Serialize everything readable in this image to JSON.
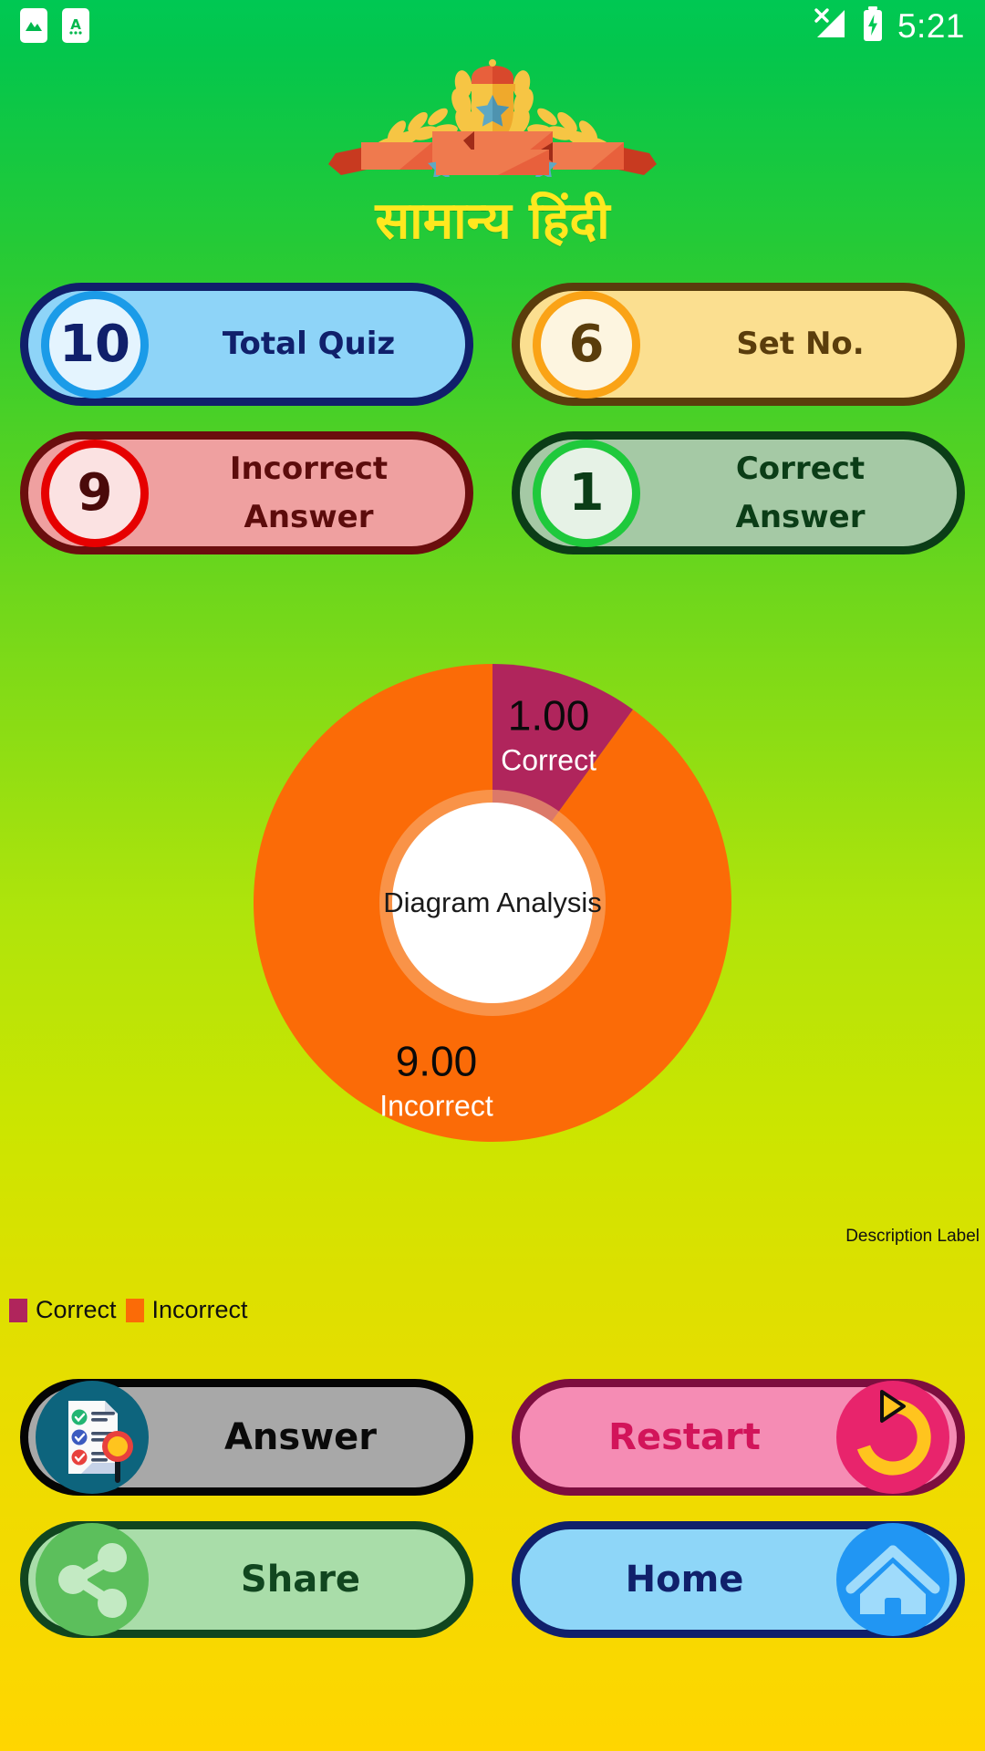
{
  "status_bar": {
    "time": "5:21",
    "icons": [
      "image-notification-icon",
      "app-notification-icon",
      "signal-no-service-icon",
      "battery-charging-icon"
    ]
  },
  "header": {
    "title": "सामान्य हिंदी",
    "trophy_icon": "trophy-banner-icon"
  },
  "stats": [
    {
      "value": "10",
      "label": "Total Quiz",
      "name": "total-quiz"
    },
    {
      "value": "6",
      "label": "Set No.",
      "name": "set-no"
    },
    {
      "value": "9",
      "label": "Incorrect\nAnswer",
      "line1": "Incorrect",
      "line2": "Answer",
      "name": "incorrect-answer"
    },
    {
      "value": "1",
      "label": "Correct\nAnswer",
      "line1": "Correct",
      "line2": "Answer",
      "name": "correct-answer"
    }
  ],
  "chart_data": {
    "type": "pie",
    "variant": "donut",
    "title": "Diagram Analysis",
    "center_label": "Diagram Analysis",
    "description_label": "Description Label",
    "categories": [
      "Correct",
      "Incorrect"
    ],
    "values": [
      1.0,
      9.0
    ],
    "value_labels": [
      "1.00",
      "9.00"
    ],
    "colors": [
      "#B0255C",
      "#FB6B07"
    ],
    "total": 10,
    "start_angle_deg": 0,
    "direction": "clockwise",
    "inner_radius_ratio": 0.42,
    "inner_ring_color": "#F7AC71",
    "center_fill": "#FFFFFF",
    "legend": {
      "position": "bottom-left",
      "entries": [
        {
          "label": "Correct",
          "color": "#B0255C"
        },
        {
          "label": "Incorrect",
          "color": "#FB6B07"
        }
      ]
    },
    "grid": false,
    "xlabel": "",
    "ylabel": ""
  },
  "actions": [
    {
      "label": "Answer",
      "name": "answer-button",
      "icon": "checklist-magnifier-icon"
    },
    {
      "label": "Restart",
      "name": "restart-button",
      "icon": "refresh-arrow-icon"
    },
    {
      "label": "Share",
      "name": "share-button",
      "icon": "share-nodes-icon"
    },
    {
      "label": "Home",
      "name": "home-button",
      "icon": "house-icon"
    }
  ],
  "theme": {
    "bg_top": "#00C853",
    "bg_mid": "#CCE500",
    "bg_bottom": "#FFD600",
    "title_color": "#FFE81F",
    "correct_color": "#B0255C",
    "incorrect_color": "#FB6B07"
  }
}
